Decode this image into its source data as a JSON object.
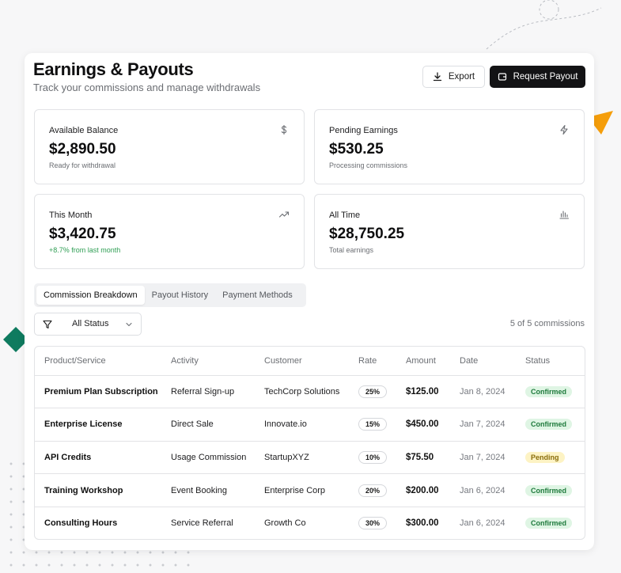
{
  "header": {
    "title": "Earnings & Payouts",
    "subtitle": "Track your commissions and manage withdrawals",
    "export_label": "Export",
    "payout_label": "Request Payout"
  },
  "stats": [
    {
      "label": "Available Balance",
      "value": "$2,890.50",
      "note": "Ready for withdrawal",
      "icon": "dollar-icon"
    },
    {
      "label": "Pending Earnings",
      "value": "$530.25",
      "note": "Processing commissions",
      "icon": "lightning-icon"
    },
    {
      "label": "This Month",
      "value": "$3,420.75",
      "note": "+8.7% from last month",
      "icon": "trending-up-icon"
    },
    {
      "label": "All Time",
      "value": "$28,750.25",
      "note": "Total earnings",
      "icon": "bar-chart-icon"
    }
  ],
  "tabs": [
    "Commission Breakdown",
    "Payout History",
    "Payment Methods"
  ],
  "active_tab": "Commission Breakdown",
  "filter": {
    "label": "All Status"
  },
  "count_text": "5 of 5 commissions",
  "table": {
    "columns": [
      "Product/Service",
      "Activity",
      "Customer",
      "Rate",
      "Amount",
      "Date",
      "Status"
    ],
    "rows": [
      {
        "product": "Premium Plan Subscription",
        "activity": "Referral Sign-up",
        "customer": "TechCorp Solutions",
        "rate": "25%",
        "amount": "$125.00",
        "date": "Jan 8, 2024",
        "status": "Confirmed"
      },
      {
        "product": "Enterprise License",
        "activity": "Direct Sale",
        "customer": "Innovate.io",
        "rate": "15%",
        "amount": "$450.00",
        "date": "Jan 7, 2024",
        "status": "Confirmed"
      },
      {
        "product": "API Credits",
        "activity": "Usage Commission",
        "customer": "StartupXYZ",
        "rate": "10%",
        "amount": "$75.50",
        "date": "Jan 7, 2024",
        "status": "Pending"
      },
      {
        "product": "Training Workshop",
        "activity": "Event Booking",
        "customer": "Enterprise Corp",
        "rate": "20%",
        "amount": "$200.00",
        "date": "Jan 6, 2024",
        "status": "Confirmed"
      },
      {
        "product": "Consulting Hours",
        "activity": "Service Referral",
        "customer": "Growth Co",
        "rate": "30%",
        "amount": "$300.00",
        "date": "Jan 6, 2024",
        "status": "Confirmed"
      }
    ]
  },
  "colors": {
    "accent_orange": "#f59e0b",
    "accent_green": "#0f7b5f",
    "confirmed_bg": "#dff5e4",
    "pending_bg": "#fdf3c4"
  }
}
